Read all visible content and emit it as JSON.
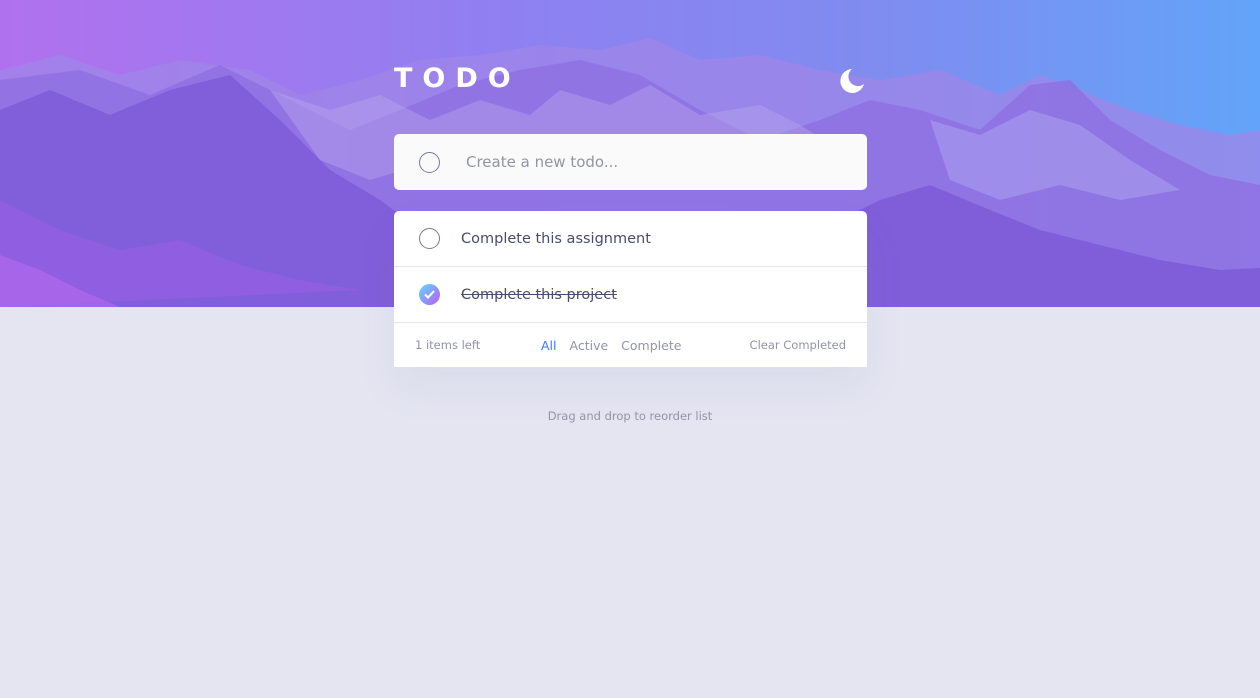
{
  "app": {
    "title": "TODO"
  },
  "theme_toggle": {
    "icon": "moon-icon"
  },
  "new_todo": {
    "placeholder": "Create a new todo...",
    "value": ""
  },
  "todos": [
    {
      "text": "Complete this assignment",
      "completed": false
    },
    {
      "text": "Complete this project",
      "completed": true
    }
  ],
  "footer": {
    "items_left": "1 items left",
    "filters": {
      "all": "All",
      "active": "Active",
      "complete": "Complete",
      "selected": "All"
    },
    "clear_completed": "Clear Completed"
  },
  "hint": "Drag and drop to reorder list",
  "colors": {
    "accent": "#3a7bfd",
    "check_gradient_start": "#57ddff",
    "check_gradient_end": "#c058f3",
    "page_background": "#e4e5f1",
    "hero_gradient_start": "#a56ef2",
    "hero_gradient_end": "#5fa0f8"
  }
}
